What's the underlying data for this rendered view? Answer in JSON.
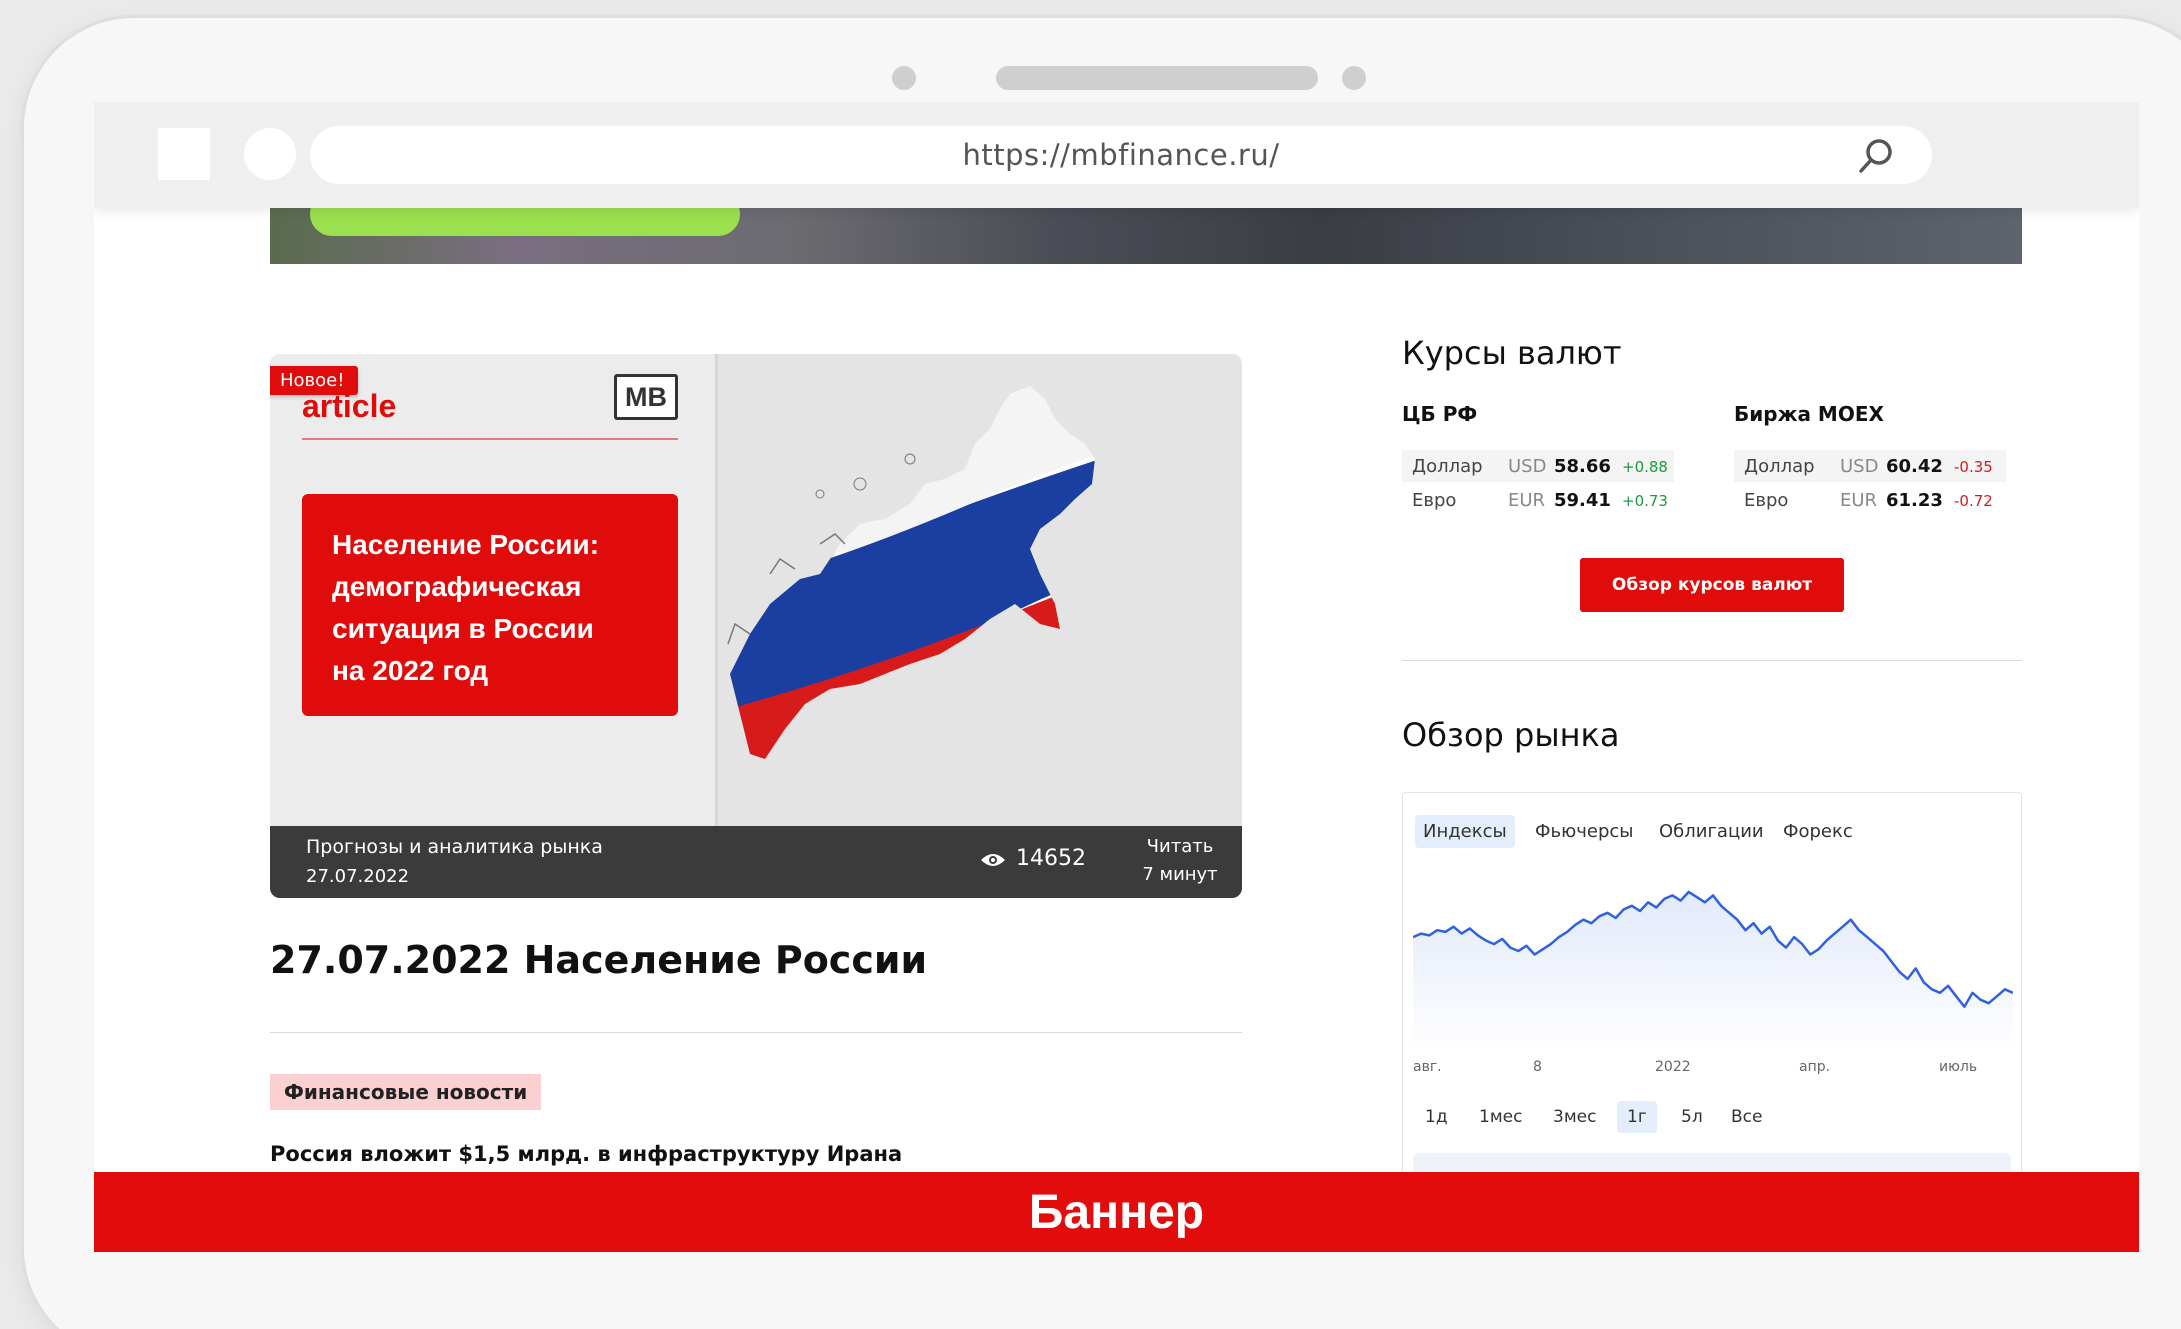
{
  "browser": {
    "url": "https://mbfinance.ru/"
  },
  "article_image": {
    "badge": "Новое!",
    "brand": "article",
    "logo": "MB",
    "card_lines": [
      "Население России:",
      "демографическая",
      "ситуация в России",
      "на 2022 год"
    ],
    "category": "Прогнозы и аналитика рынка",
    "date": "27.07.2022",
    "views": "14652",
    "read_label": "Читать",
    "read_time": "7 минут"
  },
  "article": {
    "title": "27.07.2022 Население России",
    "tag": "Финансовые новости",
    "news_headline": "Россия вложит $1,5 млрд. в инфраструктуру Ирана"
  },
  "rates": {
    "title": "Курсы валют",
    "columns": [
      {
        "name": "ЦБ РФ",
        "rows": [
          {
            "name": "Доллар",
            "code": "USD",
            "value": "58.66",
            "change": "+0.88",
            "dir": "pos"
          },
          {
            "name": "Евро",
            "code": "EUR",
            "value": "59.41",
            "change": "+0.73",
            "dir": "pos"
          }
        ]
      },
      {
        "name": "Биржа MOEX",
        "rows": [
          {
            "name": "Доллар",
            "code": "USD",
            "value": "60.42",
            "change": "-0.35",
            "dir": "neg"
          },
          {
            "name": "Евро",
            "code": "EUR",
            "value": "61.23",
            "change": "-0.72",
            "dir": "neg"
          }
        ]
      }
    ],
    "button_label": "Обзор курсов валют"
  },
  "market": {
    "title": "Обзор рынка",
    "tabs": [
      "Индексы",
      "Фьючерсы",
      "Облигации",
      "Форекс"
    ],
    "active_tab": 0,
    "x_ticks": [
      "авг.",
      "8",
      "2022",
      "апр.",
      "июль"
    ],
    "periods": [
      "1д",
      "1мес",
      "3мес",
      "1г",
      "5л",
      "Все"
    ],
    "active_period": 3,
    "line_color": "#2f62e0"
  },
  "chart_data": {
    "type": "line",
    "x_labels": [
      "авг.",
      "8",
      "2022",
      "апр.",
      "июль"
    ],
    "series": [
      {
        "values": [
          62,
          64,
          63,
          66,
          65,
          68,
          64,
          67,
          63,
          60,
          58,
          61,
          56,
          54,
          57,
          52,
          55,
          58,
          62,
          65,
          69,
          72,
          70,
          74,
          76,
          73,
          78,
          80,
          77,
          82,
          79,
          84,
          86,
          83,
          88,
          85,
          82,
          86,
          80,
          76,
          72,
          66,
          70,
          64,
          68,
          60,
          56,
          62,
          58,
          52,
          55,
          60,
          64,
          68,
          72,
          66,
          62,
          58,
          54,
          48,
          42,
          38,
          44,
          36,
          32,
          30,
          34,
          28,
          22,
          30,
          26,
          24,
          28,
          32,
          30
        ]
      }
    ],
    "ylim": [
      0,
      100
    ],
    "grid": false
  },
  "banner": {
    "label": "Баннер"
  },
  "colors": {
    "brand_red": "#e00b0b",
    "banner_red": "#e20c0c",
    "tag_bg": "#fad0d0",
    "positive": "#1a9b3a",
    "negative": "#d81a1a"
  }
}
